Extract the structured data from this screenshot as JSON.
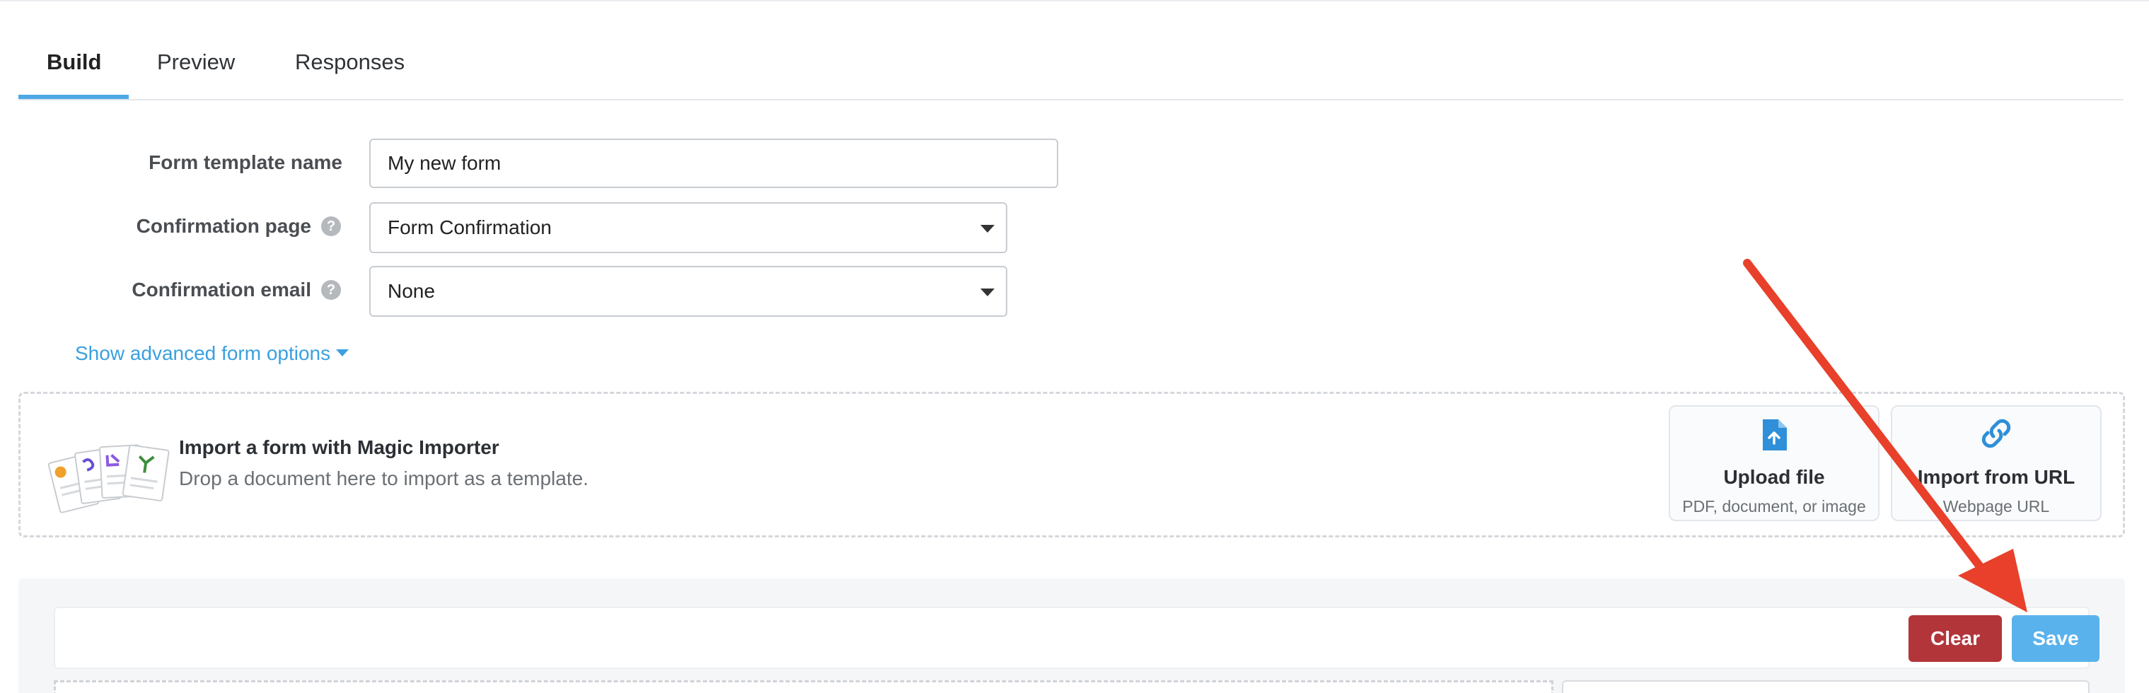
{
  "tabs": [
    {
      "label": "Build",
      "active": true
    },
    {
      "label": "Preview",
      "active": false
    },
    {
      "label": "Responses",
      "active": false
    }
  ],
  "form": {
    "template_name_label": "Form template name",
    "template_name_value": "My new form",
    "confirmation_page_label": "Confirmation page",
    "confirmation_page_value": "Form Confirmation",
    "confirmation_email_label": "Confirmation email",
    "confirmation_email_value": "None",
    "help_glyph": "?",
    "advanced_link": "Show advanced form options"
  },
  "importer": {
    "title": "Import a form with Magic Importer",
    "subtitle": "Drop a document here to import as a template.",
    "upload": {
      "title": "Upload file",
      "subtitle": "PDF, document, or image",
      "icon": "file-upload-icon"
    },
    "url": {
      "title": "Import from URL",
      "subtitle": "Webpage URL",
      "icon": "link-icon"
    }
  },
  "toolbar": {
    "clear_label": "Clear",
    "save_label": "Save"
  },
  "colors": {
    "accent": "#4fa8e6",
    "link": "#3aa0e0",
    "clear_button": "#b2353a",
    "save_button": "#5ab2ec",
    "annotation_arrow": "#e8402a"
  }
}
